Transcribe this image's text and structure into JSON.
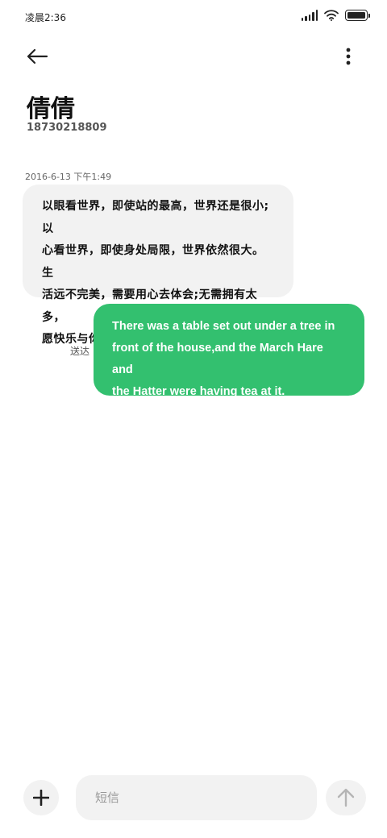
{
  "status_bar": {
    "time": "凌晨2:36",
    "battery_level": 1.0,
    "icons": [
      "signal-icon",
      "wifi-icon",
      "battery-icon"
    ]
  },
  "header": {
    "back_icon": "arrow-left-icon",
    "more_icon": "more-vertical-icon",
    "contact_name": "倩倩",
    "contact_number": "18730218809"
  },
  "conversation": {
    "timestamp": "2016-6-13 下午1:49",
    "incoming": {
      "lines": [
        "以眼看世界，即使站的最高，世界还是很小;以",
        "心看世界，即使身处局限，世界依然很大。生",
        "活远不完美，需要用心去体会;无需拥有太多，",
        "愿快乐与你相随。"
      ]
    },
    "outgoing": {
      "status": "送达",
      "lines": [
        "There was a table set out under a tree in",
        "front of the house,and the March Hare and",
        "the Hatter were having tea at it."
      ]
    }
  },
  "composer": {
    "add_icon": "plus-icon",
    "placeholder": "短信",
    "value": "",
    "send_icon": "arrow-up-icon"
  },
  "colors": {
    "outgoing_bubble": "#33c06f",
    "incoming_bubble": "#f2f2f2",
    "background": "#ffffff"
  }
}
